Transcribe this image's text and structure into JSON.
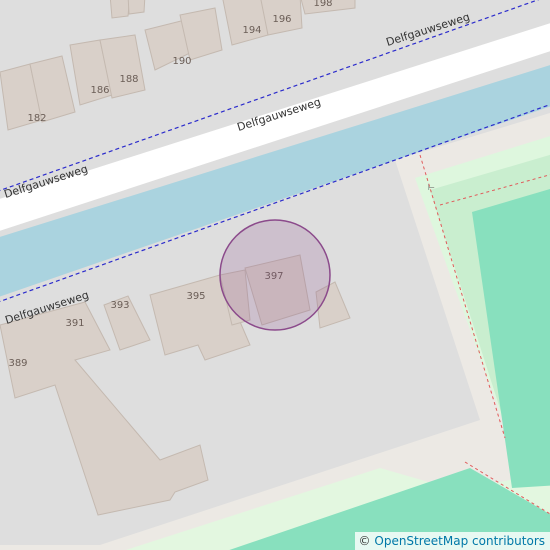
{
  "map": {
    "roads": {
      "upper": "Delfgauwseweg",
      "upper_left": "Delfgauwseweg",
      "lower": "Delfgauwseweg"
    },
    "house_numbers": {
      "n182": "182",
      "n186": "186",
      "n188": "188",
      "n190": "190",
      "n194": "194",
      "n196": "196",
      "n198": "198",
      "n389": "389",
      "n391": "391",
      "n393": "393",
      "n395": "395",
      "n397": "397"
    },
    "marker": {
      "house_number": "397",
      "color": "#8b4a8b"
    },
    "attribution": {
      "symbol": "©",
      "link": "OpenStreetMap contributors"
    }
  }
}
